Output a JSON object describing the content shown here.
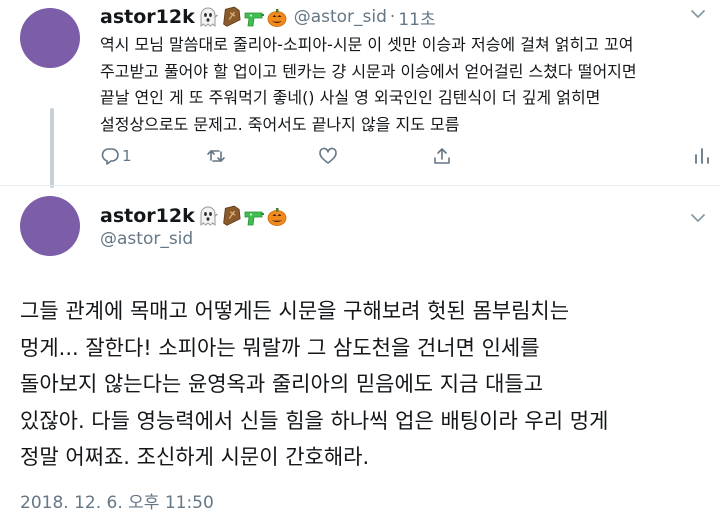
{
  "tweet1": {
    "name": "astor12k",
    "emojis": [
      "ghost-emoji",
      "coffin-emoji",
      "water-pistol-emoji",
      "jack-o-lantern-emoji"
    ],
    "handle": "@astor_sid",
    "separator": "·",
    "time": "11초",
    "lines": [
      "역시 모님 말씀대로 줄리아-소피아-시문 이 셋만 이승과 저승에 걸쳐 얽히고 꼬여",
      "주고받고 풀어야 할 업이고 텐카는 걍 시문과 이승에서 얻어걸린 스쳤다 떨어지면",
      "끝날 연인 게 또 주워먹기 좋네() 사실 영 외국인인 김텐식이 더 깊게 얽히면",
      "설정상으로도 문제고. 죽어서도 끝나지 않을 지도 모름"
    ],
    "reply_count": "1"
  },
  "tweet2": {
    "name": "astor12k",
    "emojis": [
      "ghost-emoji",
      "coffin-emoji",
      "water-pistol-emoji",
      "jack-o-lantern-emoji"
    ],
    "handle": "@astor_sid",
    "lines": [
      "그들 관계에 목매고 어떻게든 시문을 구해보려 헛된 몸부림치는",
      "멍게... 잘한다! 소피아는 뭐랄까 그 삼도천을 건너면 인세를",
      "돌아보지 않는다는 윤영옥과 줄리아의 믿음에도 지금 대들고",
      "있잖아. 다들 영능력에서 신들 힘을 하나씩 업은 배팅이라 우리 멍게",
      "정말 어쩌죠. 조신하게 시문이 간호해라."
    ],
    "timestamp": "2018. 12. 6. 오후 11:50"
  },
  "colors": {
    "avatar": "#7b5da8",
    "muted_text": "#657786",
    "thread_line": "#c6d0d8",
    "divider": "#e6ecf0"
  }
}
